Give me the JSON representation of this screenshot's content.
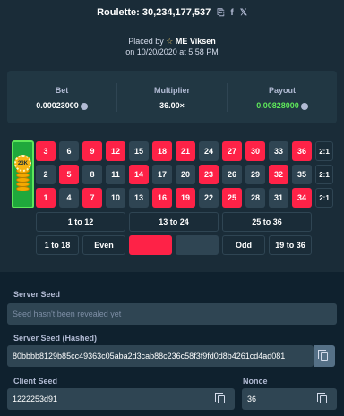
{
  "header": {
    "title": "Roulette: 30,234,177,537",
    "placed_by_prefix": "Placed by",
    "user": "ME Viksen",
    "date_line": "on 10/20/2020 at 5:58 PM"
  },
  "stats": {
    "bet_label": "Bet",
    "bet_value": "0.00023000",
    "multiplier_label": "Multiplier",
    "multiplier_value": "36.00×",
    "payout_label": "Payout",
    "payout_value": "0.00828000",
    "payout_color": "#5ee65a"
  },
  "board": {
    "chip_label": "23K",
    "rows": [
      [
        "3",
        "6",
        "9",
        "12",
        "15",
        "18",
        "21",
        "24",
        "27",
        "30",
        "33",
        "36"
      ],
      [
        "2",
        "5",
        "8",
        "11",
        "14",
        "17",
        "20",
        "23",
        "26",
        "29",
        "32",
        "35"
      ],
      [
        "1",
        "4",
        "7",
        "10",
        "13",
        "16",
        "19",
        "22",
        "25",
        "28",
        "31",
        "34"
      ]
    ],
    "red_numbers": [
      "1",
      "3",
      "5",
      "7",
      "9",
      "12",
      "14",
      "16",
      "18",
      "19",
      "21",
      "23",
      "25",
      "27",
      "30",
      "32",
      "34",
      "36"
    ],
    "column_label": "2:1",
    "dozens": [
      "1 to 12",
      "13 to 24",
      "25 to 36"
    ],
    "outside": {
      "low": "1 to 18",
      "even": "Even",
      "odd": "Odd",
      "high": "19 to 36"
    }
  },
  "fairness": {
    "server_seed_label": "Server Seed",
    "server_seed_placeholder": "Seed hasn't been revealed yet",
    "server_seed_hashed_label": "Server Seed (Hashed)",
    "server_seed_hashed_value": "80bbbb8129b85cc49363c05aba2d3cab88c236c58f3f9fd0d8b4261cd4ad081",
    "client_seed_label": "Client Seed",
    "client_seed_value": "1222253d91",
    "nonce_label": "Nonce",
    "nonce_value": "36"
  },
  "colors": {
    "red": "#fe2247",
    "black": "#2f4553",
    "green": "#1fa83c",
    "background": "#1a2c38"
  },
  "icons": [
    "copy-icon",
    "facebook-icon",
    "twitter-icon",
    "star-icon",
    "coin-icon"
  ]
}
